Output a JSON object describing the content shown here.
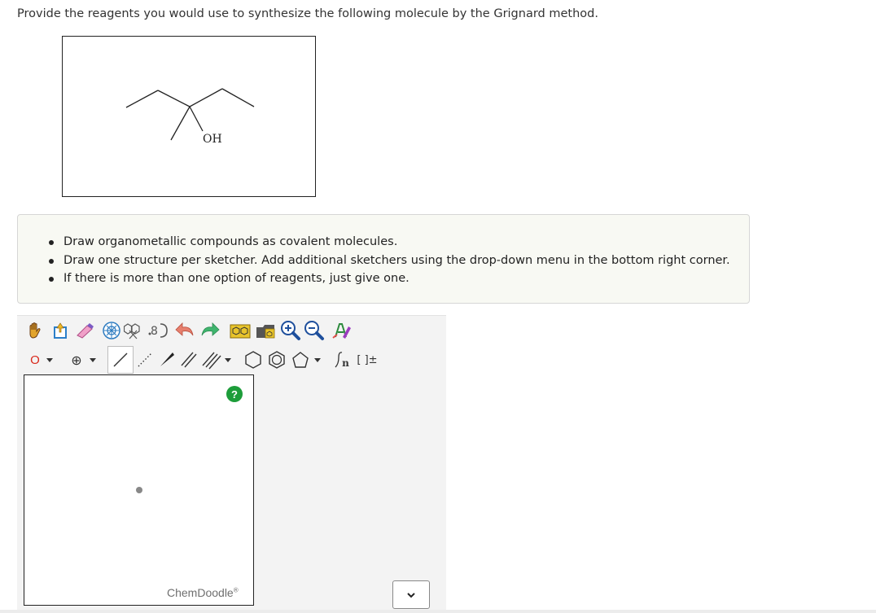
{
  "question": {
    "text": "Provide the reagents you would use to synthesize the following molecule by the Grignard method."
  },
  "molecule": {
    "oh_label": "OH"
  },
  "instructions": {
    "items": [
      "Draw organometallic compounds as covalent molecules.",
      "Draw one structure per sketcher. Add additional sketchers using the drop-down menu in the bottom right corner.",
      "If there is more than one option of reagents, just give one."
    ]
  },
  "sketcher": {
    "atom_label": "O",
    "charge_label": "⊕",
    "brand": "ChemDoodle",
    "brand_mark": "®",
    "help_label": "?",
    "bracket_label": "[ ]±",
    "sn_label": "n",
    "toolbar_row1_icons": [
      "hand-icon",
      "clear-icon",
      "eraser-icon",
      "center-icon",
      "copy-icon",
      "flip-icon",
      "undo-icon",
      "redo-icon",
      "template-icon",
      "open-icon",
      "zoom-in-icon",
      "zoom-out-icon",
      "clean-icon"
    ],
    "toolbar_row2_icons": [
      "atom-o-icon",
      "charge-icon",
      "single-bond-icon",
      "dashed-bond-icon",
      "wedge-bond-icon",
      "double-bond-icon",
      "triple-bond-icon",
      "hexagon-icon",
      "benzene-icon",
      "pentagon-icon",
      "sn-icon",
      "bracket-icon"
    ],
    "colors": {
      "atom_o": "#d9291c",
      "help": "#1d9d3a",
      "undo": "#e77f6e",
      "redo": "#3fb56e"
    }
  },
  "sketcher_dropdown": {
    "icon": "chevron-down-icon"
  }
}
